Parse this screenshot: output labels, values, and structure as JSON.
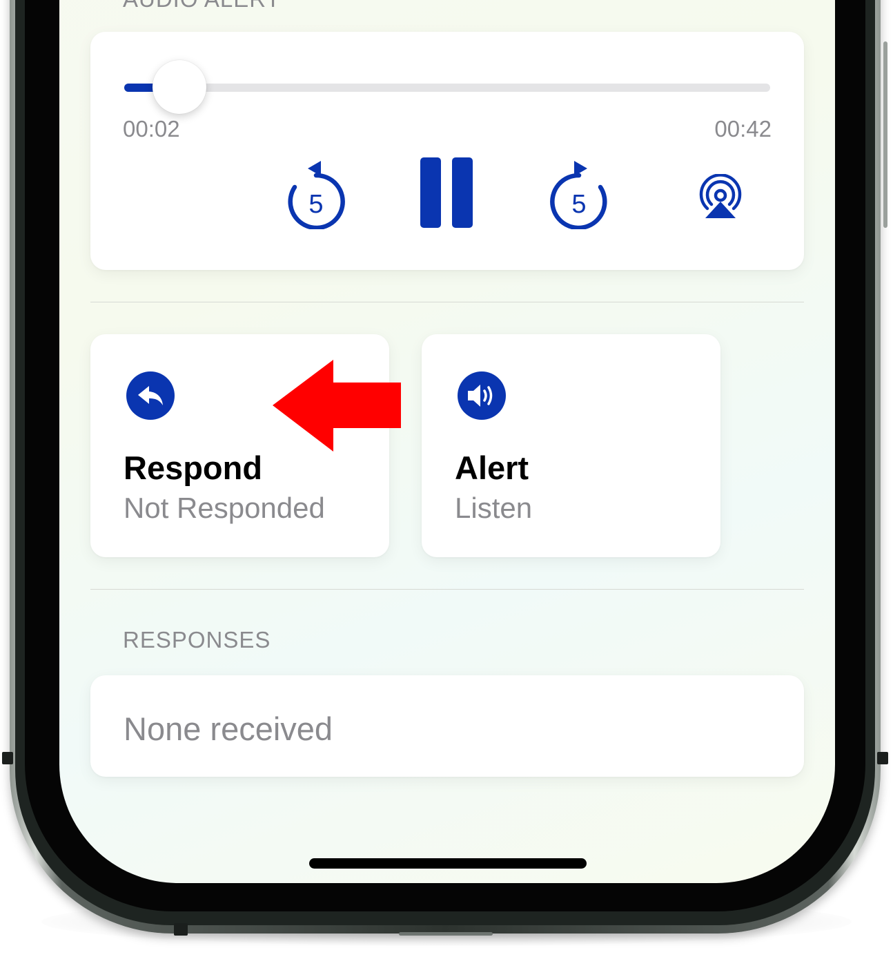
{
  "audio_alert": {
    "section_label": "AUDIO ALERT",
    "progress_fraction": 0.085,
    "elapsed": "00:02",
    "duration": "00:42",
    "rewind_seconds": "5",
    "forward_seconds": "5",
    "controls": {
      "rewind_icon": "rewind-5-icon",
      "pause_icon": "pause-icon",
      "forward_icon": "forward-5-icon",
      "airplay_icon": "airplay-icon"
    }
  },
  "actions": [
    {
      "title": "Respond",
      "subtitle": "Not Responded",
      "icon": "reply-icon"
    },
    {
      "title": "Alert",
      "subtitle": "Listen",
      "icon": "speaker-icon"
    }
  ],
  "responses": {
    "section_label": "RESPONSES",
    "empty_text": "None received"
  },
  "colors": {
    "accent": "#0a35b0",
    "annotation_arrow": "#ff0000",
    "secondary_text": "#8a8a8e"
  }
}
